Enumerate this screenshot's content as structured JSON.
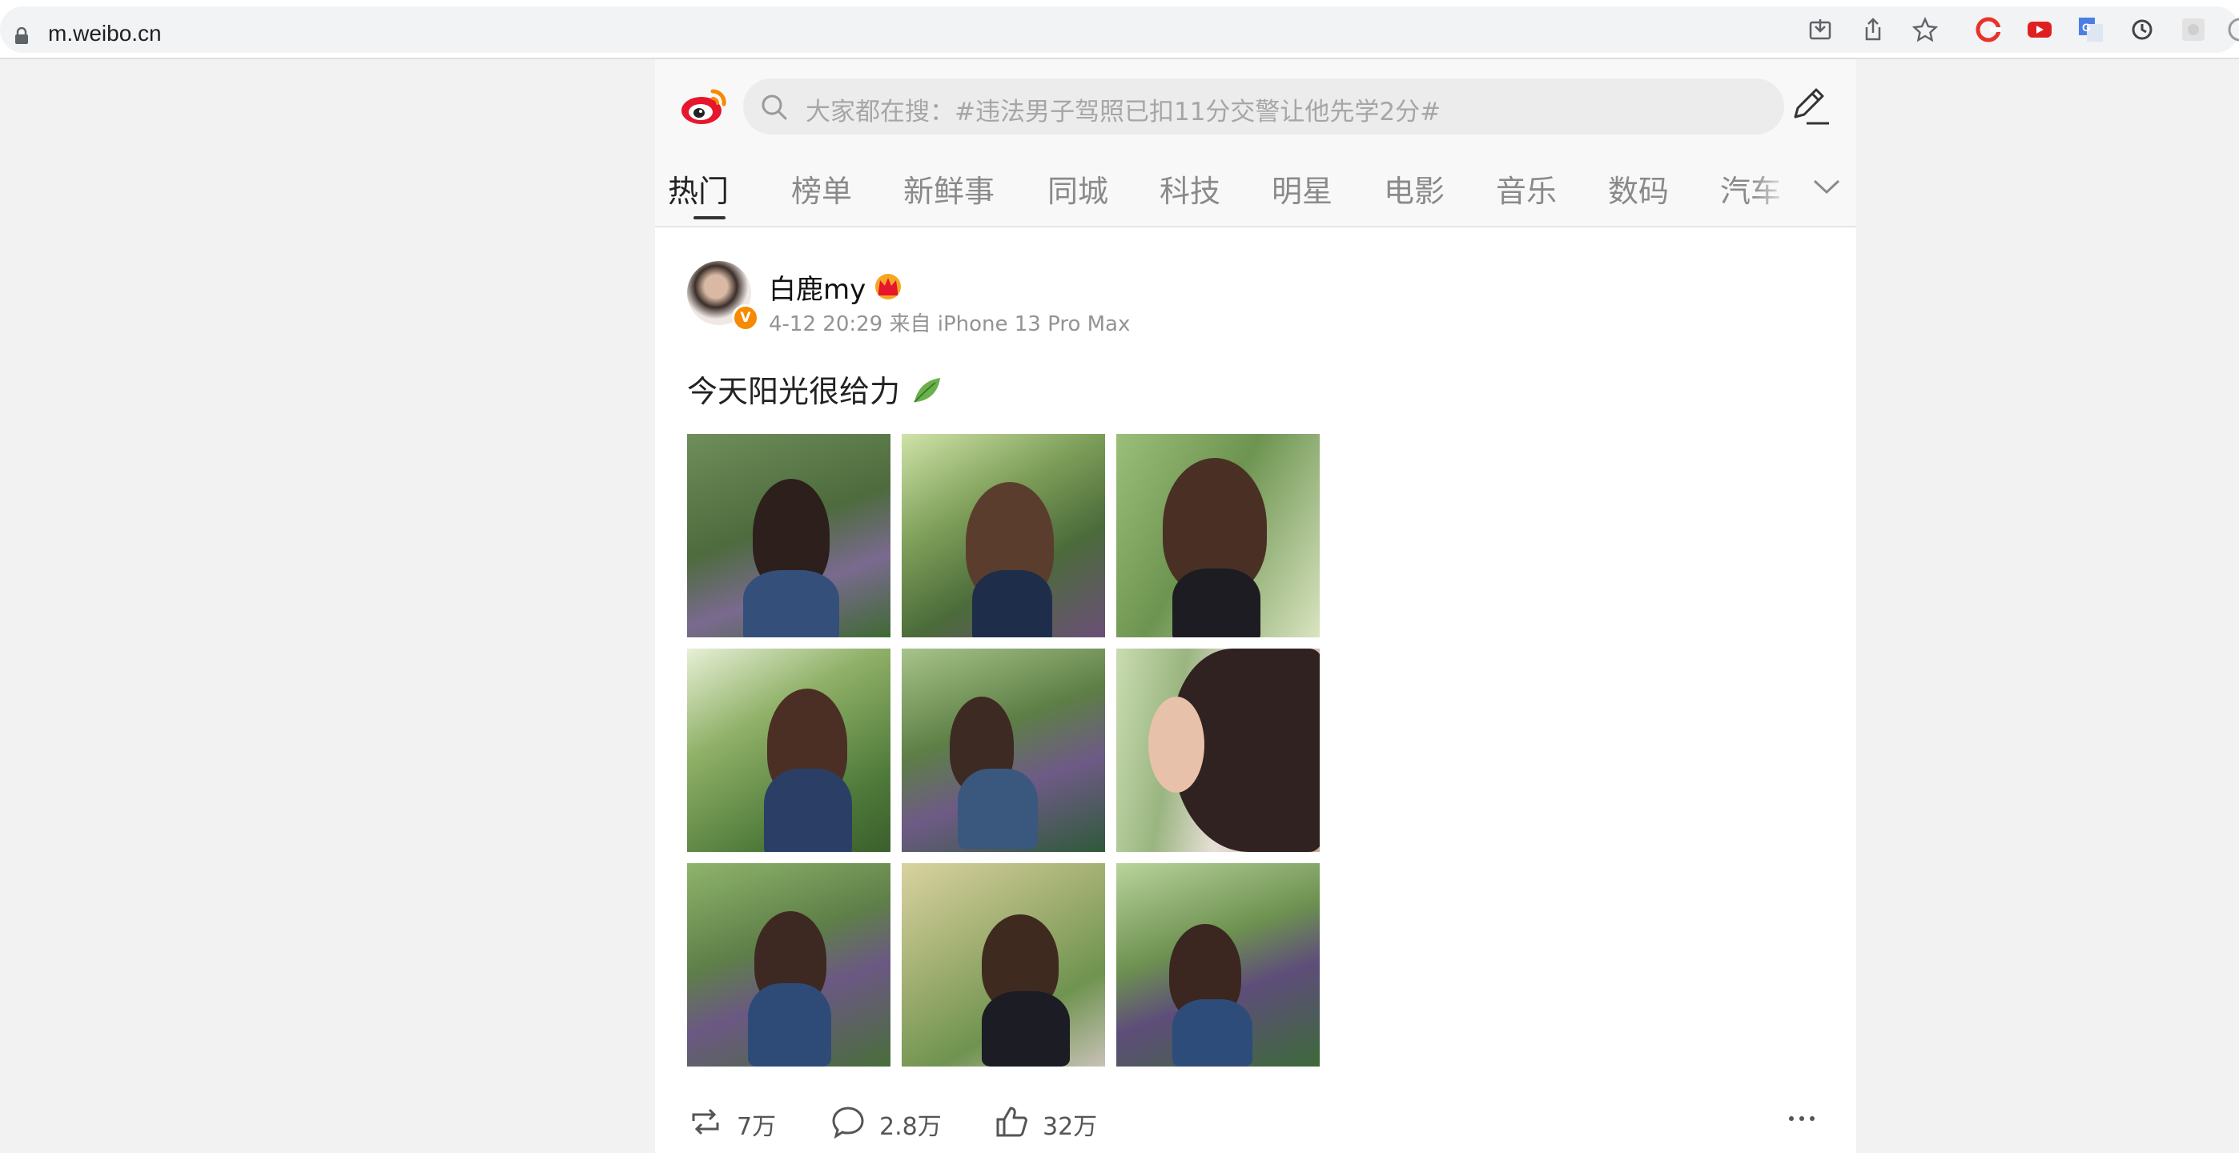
{
  "browser": {
    "url": "m.weibo.cn",
    "toolbar_icons": [
      "install-icon",
      "share-icon",
      "bookmark-star-icon",
      "extension-c-icon",
      "extension-youtube-icon",
      "extension-translate-icon",
      "extension-sync-icon",
      "extension-grey-icon"
    ]
  },
  "header": {
    "search_placeholder": "大家都在搜：#违法男子驾照已扣11分交警让他先学2分#",
    "tabs": [
      {
        "label": "热门",
        "active": true
      },
      {
        "label": "榜单"
      },
      {
        "label": "新鲜事"
      },
      {
        "label": "同城"
      },
      {
        "label": "科技"
      },
      {
        "label": "明星"
      },
      {
        "label": "电影"
      },
      {
        "label": "音乐"
      },
      {
        "label": "数码"
      },
      {
        "label": "汽车"
      }
    ]
  },
  "post": {
    "username": "白鹿my",
    "verified_badge": "V",
    "meta": "4-12 20:29 来自 iPhone 13 Pro Max",
    "text": "今天阳光很给力",
    "photos": [
      "photo-1",
      "photo-2",
      "photo-3",
      "photo-4",
      "photo-5",
      "photo-6",
      "photo-7",
      "photo-8",
      "photo-9"
    ],
    "reposts": "7万",
    "comments": "2.8万",
    "likes": "32万"
  },
  "colors": {
    "weibo_red": "#e6162d",
    "weibo_orange": "#f78a00",
    "text_grey": "#939393"
  }
}
